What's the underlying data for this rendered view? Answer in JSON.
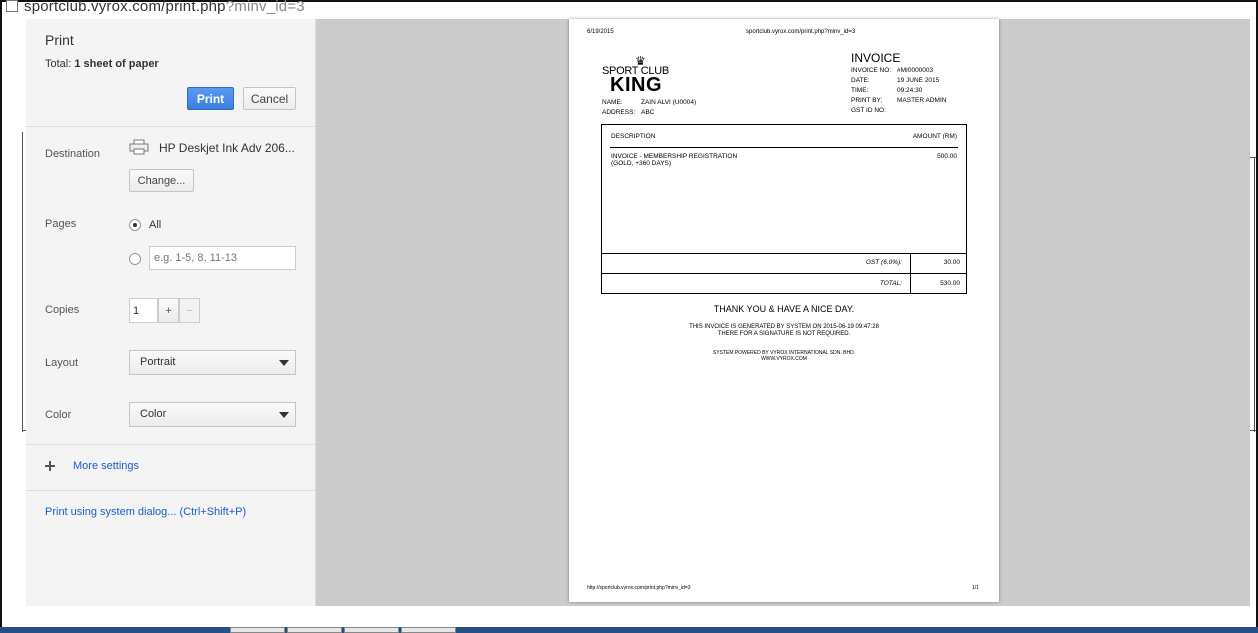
{
  "browser": {
    "url_main": "sportclub.vyrox.com/print.php",
    "url_query": "?minv_id=3"
  },
  "print_panel": {
    "title": "Print",
    "total_label": "Total:",
    "total_value": "1 sheet of paper",
    "print_button": "Print",
    "cancel_button": "Cancel",
    "destination": {
      "label": "Destination",
      "printer_name": "HP Deskjet Ink Adv 206...",
      "change_button": "Change..."
    },
    "pages": {
      "label": "Pages",
      "option_all": "All",
      "custom_placeholder": "e.g. 1-5, 8, 11-13",
      "selected": "All"
    },
    "copies": {
      "label": "Copies",
      "value": "1",
      "plus": "+",
      "minus": "−"
    },
    "layout": {
      "label": "Layout",
      "value": "Portrait"
    },
    "color": {
      "label": "Color",
      "value": "Color"
    },
    "more_settings": "More settings",
    "system_dialog": "Print using system dialog... (Ctrl+Shift+P)"
  },
  "invoice_page": {
    "header_date": "6/19/2015",
    "header_url": "sportclub.vyrox.com/print.php?minv_id=3",
    "logo_line1": "SPORT CLUB",
    "logo_line2": "KING",
    "title": "INVOICE",
    "meta": [
      {
        "k": "INVOICE NO:",
        "v": "#MI0000003"
      },
      {
        "k": "DATE:",
        "v": "19 JUNE 2015"
      },
      {
        "k": "TIME:",
        "v": "09:24:30"
      },
      {
        "k": "PRINT BY:",
        "v": "MASTER ADMIN"
      },
      {
        "k": "GST ID NO:",
        "v": ""
      }
    ],
    "name_label": "NAME:",
    "name_value": "ZAIN ALVI (U0004)",
    "address_label": "ADDRESS:",
    "address_value": "ABC",
    "col_description": "DESCRIPTION",
    "col_amount": "AMOUNT (RM)",
    "item_line1": "INVOICE - MEMBERSHIP REGISTRATION",
    "item_line2": "(GOLD, +360 DAYS)",
    "item_amount": "500.00",
    "gst_label": "GST (6.0%):",
    "gst_value": "30.00",
    "total_label": "TOTAL:",
    "total_value": "530.00",
    "thanks": "THANK YOU & HAVE A NICE DAY.",
    "note1": "THIS INVOICE IS GENERATED BY SYSTEM ON 2015-06-19 09:47:28",
    "note2": "THERE FOR A SIGNATURE IS NOT REQUIRED.",
    "powered1": "SYSTEM POWERED BY VYROX INTERNATIONAL SDN. BHD.",
    "powered2": "WWW.VYROX.COM",
    "footer_url": "http://sportclub.vyrox.com/print.php?minv_id=3",
    "footer_page": "1/1"
  }
}
